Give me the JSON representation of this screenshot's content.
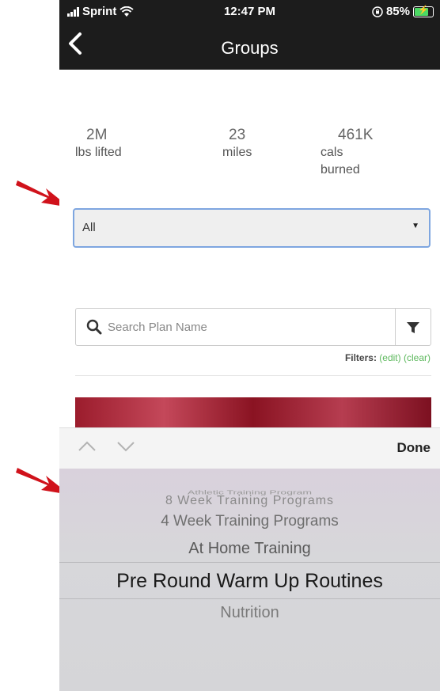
{
  "status_bar": {
    "carrier": "Sprint",
    "time": "12:47 PM",
    "battery": "85%",
    "battery_level": 0.85
  },
  "nav": {
    "title": "Groups"
  },
  "stats": [
    {
      "value": "2M",
      "label": "lbs lifted"
    },
    {
      "value": "23",
      "label": "miles"
    },
    {
      "value": "461K",
      "label": "cals burned"
    }
  ],
  "category_select": {
    "value": "All"
  },
  "search": {
    "placeholder": "Search Plan Name"
  },
  "filters": {
    "label": "Filters:",
    "edit": "(edit)",
    "clear": "(clear)"
  },
  "picker": {
    "done_label": "Done",
    "options": [
      "Athletic Training Program",
      "8 Week Training Programs",
      "4 Week Training Programs",
      "At Home Training",
      "Pre Round Warm Up Routines",
      "Nutrition"
    ],
    "selected": "Pre Round Warm Up Routines"
  },
  "colors": {
    "nav_background": "#1c1c1c",
    "filter_link": "#5cb85c",
    "select_focus_border": "#7ea6e0",
    "annotation_arrow": "#d0121b"
  }
}
